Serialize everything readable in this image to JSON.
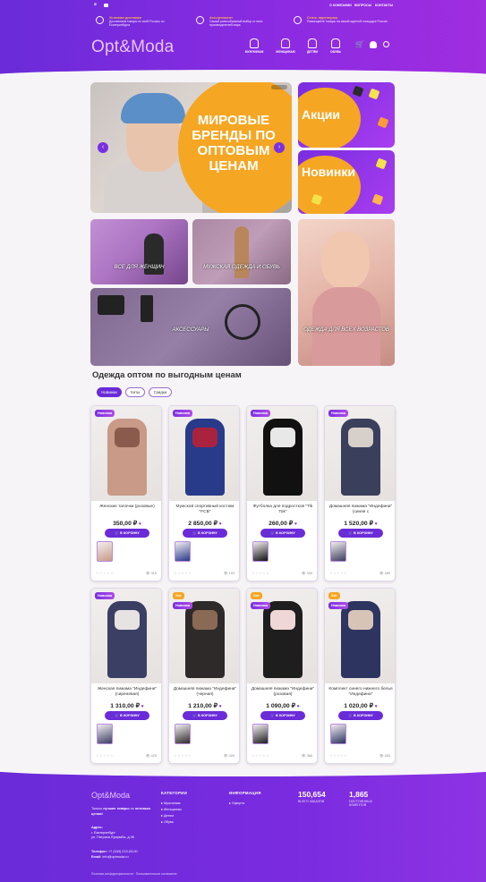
{
  "header": {
    "top_links": [
      "О КОМПАНИИ",
      "ВОПРОСЫ",
      "КОНТАКТЫ"
    ],
    "features": [
      {
        "title": "Условия доставки",
        "desc": "Доставляем товары по всей России, из Екатеринбурга",
        "icon": "truck-icon"
      },
      {
        "title": "Ассортимент",
        "desc": "Самый разнообразный выбор от всех производителей мира",
        "icon": "assortment-icon"
      },
      {
        "title": "Стать партнером",
        "desc": "Размещайте товары на самой крупной площадке России",
        "icon": "handshake-icon"
      }
    ],
    "logo": "Opt&Moda",
    "categories": [
      {
        "label": "МУЖЧИНАМ",
        "icon": "man-icon"
      },
      {
        "label": "ЖЕНЩИНАМ",
        "icon": "woman-icon"
      },
      {
        "label": "ДЕТЯМ",
        "icon": "stroller-icon"
      },
      {
        "label": "ОБУВЬ",
        "icon": "boot-icon"
      }
    ]
  },
  "banners": {
    "main_text": "МИРОВЫЕ БРЕНДЫ ПО ОПТОВЫМ ЦЕНАМ",
    "sale": "Акции",
    "new": "Новинки",
    "women": "ВСЕ ДЛЯ ЖЕНЩИН",
    "men": "МУЖСКАЯ ОДЕЖДА И ОБУВЬ",
    "accessories": "АКСЕССУАРЫ",
    "kids": "ОДЕЖДА ДЛЯ ВСЕХ ВОЗРАСТОВ"
  },
  "section": {
    "title": "Одежда оптом по выгодным ценам",
    "tabs": [
      "Новинки",
      "Хиты",
      "Скидки"
    ]
  },
  "buy_label": "В КОРЗИНУ",
  "products": [
    {
      "name": "Женские тапочки (розовые)",
      "price": "350,00 ₽",
      "views": "310",
      "badges": [
        "Новинка"
      ],
      "colors": [
        "#c99a87",
        "#8a5a4c"
      ]
    },
    {
      "name": "Мужской спортивный костюм \"FCB\"",
      "price": "2 850,00 ₽",
      "views": "193",
      "badges": [
        "Новинка"
      ],
      "colors": [
        "#283a8a",
        "#a9233e"
      ]
    },
    {
      "name": "Футболка для подростков \"Tik Tok\"",
      "price": "260,00 ₽",
      "views": "393",
      "badges": [
        "Новинка"
      ],
      "colors": [
        "#111111",
        "#e8e8e8"
      ]
    },
    {
      "name": "Домашняя пижама \"Индефини\" (синяя с",
      "price": "1 520,00 ₽",
      "views": "285",
      "badges": [
        "Новинка"
      ],
      "colors": [
        "#3a3f5c",
        "#d7cfc9"
      ]
    },
    {
      "name": "Женская пижама \"Индефини\" (сиреневая)",
      "price": "1 310,00 ₽",
      "views": "429",
      "badges": [
        "Новинка"
      ],
      "colors": [
        "#3a3f63",
        "#e7e3e3"
      ]
    },
    {
      "name": "Домашняя пижама \"Индефини\" (черная)",
      "price": "1 210,00 ₽",
      "views": "400",
      "badges": [
        "Хит",
        "Новинка"
      ],
      "colors": [
        "#2e2a2a",
        "#8a6a55"
      ]
    },
    {
      "name": "Домашняя пижама \"Индефини\" (розовая)",
      "price": "1 090,00 ₽",
      "views": "366",
      "badges": [
        "Хит",
        "Новинка"
      ],
      "colors": [
        "#1e1e1e",
        "#f0d7d7"
      ]
    },
    {
      "name": "Комплект синего нижнего белья \"Индефини\"",
      "price": "1 020,00 ₽",
      "views": "493",
      "badges": [
        "Хит",
        "Новинка"
      ],
      "colors": [
        "#2d3460",
        "#d8c4b7"
      ]
    }
  ],
  "footer": {
    "logo": "Opt&Moda",
    "tagline_1": "Только",
    "tagline_bold": "лучшие товары",
    "tagline_2": "по",
    "tagline_bold2": "оптовым ценам!",
    "address_label": "Адрес:",
    "address_1": "г. Екатеринбург",
    "address_2": "ул. Патриса Лумумбы, д.36",
    "phone_label": "Телефон:",
    "phone": "+7 (343) 213-03-00",
    "email_label": "Email:",
    "email": "info@optmoda.ru",
    "categories_title": "КАТЕГОРИИ",
    "categories": [
      "Мужчинам",
      "Женщинам",
      "Детям",
      "Обувь"
    ],
    "info_title": "ИНФОРМАЦИЯ",
    "info": [
      "Оферта"
    ],
    "stat1_value": "150,654",
    "stat1_label": "ВСЕГО ЗАКАЗОВ",
    "stat2_value": "1,865",
    "stat2_label_1": "ПОСТОЯННЫХ",
    "stat2_label_2": "КЛИЕНТОВ",
    "legal": "Политика конфиденциальности · Пользовательское соглашение"
  }
}
